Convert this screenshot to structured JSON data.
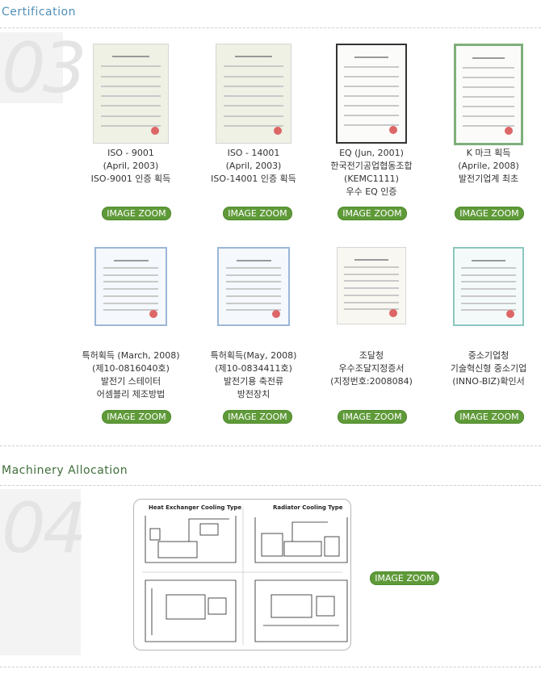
{
  "certification": {
    "title": "Certification",
    "number": "03",
    "zoom_label": "IMAGE ZOOM",
    "items": [
      {
        "lines": [
          "ISO - 9001",
          "(April, 2003)",
          "ISO-9001 인증 획득"
        ],
        "doc": "green-cert"
      },
      {
        "lines": [
          "ISO - 14001",
          "(April, 2003)",
          "ISO-14001 인증 획득"
        ],
        "doc": "green-cert"
      },
      {
        "lines": [
          "EQ (Jun, 2001)",
          "한국전기공업협동조합",
          "(KEMC1111)",
          "우수 EQ 인증"
        ],
        "doc": "framed-cert"
      },
      {
        "lines": [
          "K 마크 획득",
          "(Aprile, 2008)",
          "발전기업계 최초"
        ],
        "doc": "green-frame-cert"
      },
      {
        "lines": [
          "특허획득 (March, 2008)",
          "(제10-0816040호)",
          "발전기 스테이터",
          "어셈블리 제조방법"
        ],
        "doc": "blue-patent"
      },
      {
        "lines": [
          "특허획득(May, 2008)",
          "(제10-0834411호)",
          "발전기용 축전류",
          "방전장치"
        ],
        "doc": "blue-patent"
      },
      {
        "lines": [
          "조달청",
          "우수조달지정증서",
          "(지정번호:2008084)"
        ],
        "doc": "plain-cert"
      },
      {
        "lines": [
          "중소기업청",
          "기술혁신형 중소기업",
          "(INNO-BIZ)확인서"
        ],
        "doc": "teal-cert"
      }
    ]
  },
  "machinery": {
    "title": "Machinery Allocation",
    "number": "04",
    "zoom_label": "IMAGE ZOOM",
    "diagram": {
      "left_title": "Heat Exchanger Cooling Type",
      "right_title": "Radiator Cooling Type"
    }
  }
}
